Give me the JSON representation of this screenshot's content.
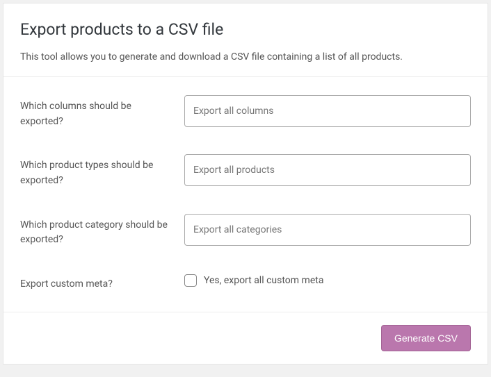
{
  "header": {
    "title": "Export products to a CSV file",
    "description": "This tool allows you to generate and download a CSV file containing a list of all products."
  },
  "form": {
    "columns": {
      "label": "Which columns should be exported?",
      "placeholder": "Export all columns"
    },
    "types": {
      "label": "Which product types should be exported?",
      "placeholder": "Export all products"
    },
    "category": {
      "label": "Which product category should be exported?",
      "placeholder": "Export all categories"
    },
    "meta": {
      "label": "Export custom meta?",
      "checkbox_label": "Yes, export all custom meta"
    }
  },
  "footer": {
    "submit_label": "Generate CSV"
  }
}
